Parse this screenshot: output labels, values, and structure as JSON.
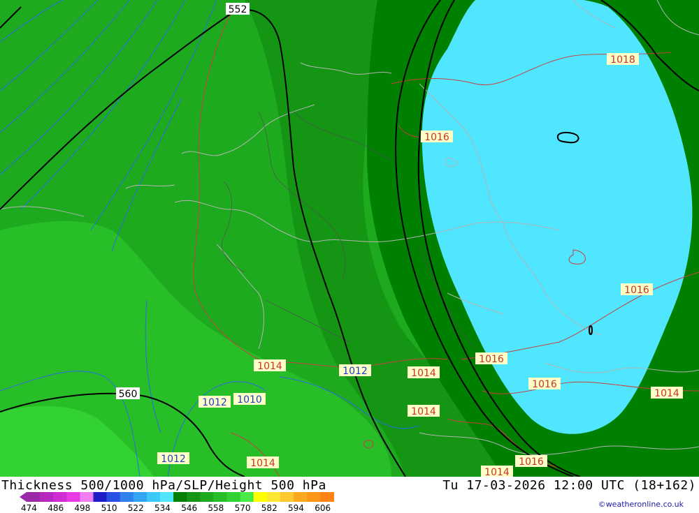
{
  "title": "Thickness 500/1000 hPa/SLP/Height 500 hPa",
  "datetime": "Tu 17-03-2026 12:00 UTC (18+162)",
  "credit": "©weatheronline.co.uk",
  "legend": {
    "colors": [
      "#9a2aa8",
      "#b52bc0",
      "#d02cd6",
      "#e83ce8",
      "#f07ef0",
      "#1e1ec8",
      "#2850e6",
      "#2d82f0",
      "#32a5f5",
      "#3cc8fa",
      "#50e6ff",
      "#008000",
      "#149614",
      "#1eaa1e",
      "#28be28",
      "#32d232",
      "#46eb46",
      "#ffff00",
      "#ffe632",
      "#ffc832",
      "#ffaa1e",
      "#ff9614",
      "#ff8214"
    ],
    "ticks": [
      "474",
      "486",
      "498",
      "510",
      "522",
      "534",
      "546",
      "558",
      "570",
      "582",
      "594",
      "606"
    ]
  },
  "map": {
    "slp_labels_red": [
      "1018",
      "1016",
      "1016",
      "1014",
      "1014",
      "1014",
      "1016",
      "1016",
      "1014",
      "1014",
      "1016",
      "1014"
    ],
    "slp_labels_blue": [
      "1012",
      "1012",
      "1010",
      "1012"
    ],
    "height_labels": [
      "552",
      "560"
    ]
  }
}
